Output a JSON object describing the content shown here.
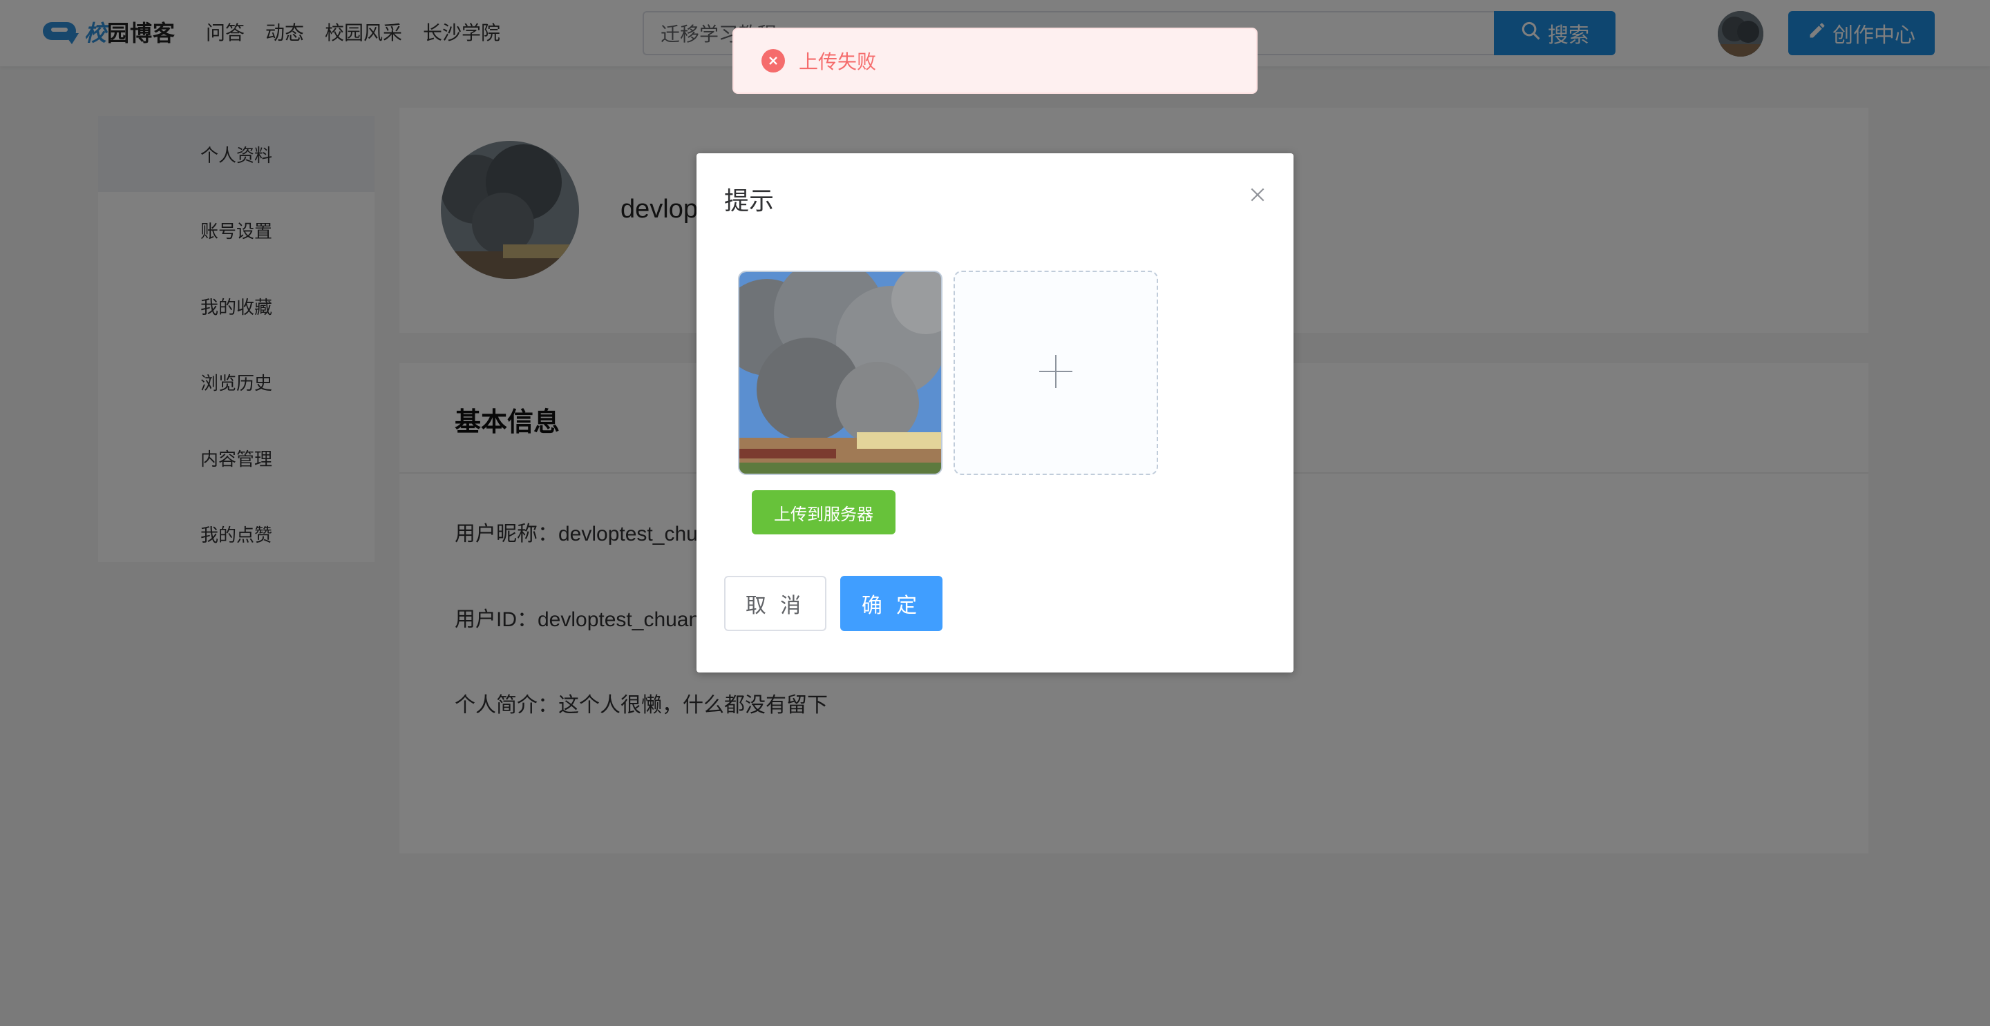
{
  "header": {
    "logo_text_first": "校",
    "logo_text_rest": "园博客",
    "nav": [
      "问答",
      "动态",
      "校园风采",
      "长沙学院"
    ],
    "search_value": "迁移学习教程",
    "search_button": "搜索",
    "create_button": "创作中心"
  },
  "sidebar": {
    "items": [
      "个人资料",
      "账号设置",
      "我的收藏",
      "浏览历史",
      "内容管理",
      "我的点赞"
    ]
  },
  "profile": {
    "name": "devloptest_chuangyingming"
  },
  "info": {
    "title": "基本信息",
    "nickname": "用户昵称：devloptest_chuangyingming",
    "user_id": "用户ID：devloptest_chuangyingming",
    "bio": "个人简介：这个人很懒，什么都没有留下"
  },
  "dialog": {
    "title": "提示",
    "upload_server_button": "上传到服务器",
    "cancel_button": "取 消",
    "confirm_button": "确 定"
  },
  "toast": {
    "message": "上传失败"
  },
  "colors": {
    "primary": "#1d8ce0",
    "dialog_confirm": "#409eff",
    "upload_server": "#67c23a",
    "toast_error": "#f56c6c"
  }
}
